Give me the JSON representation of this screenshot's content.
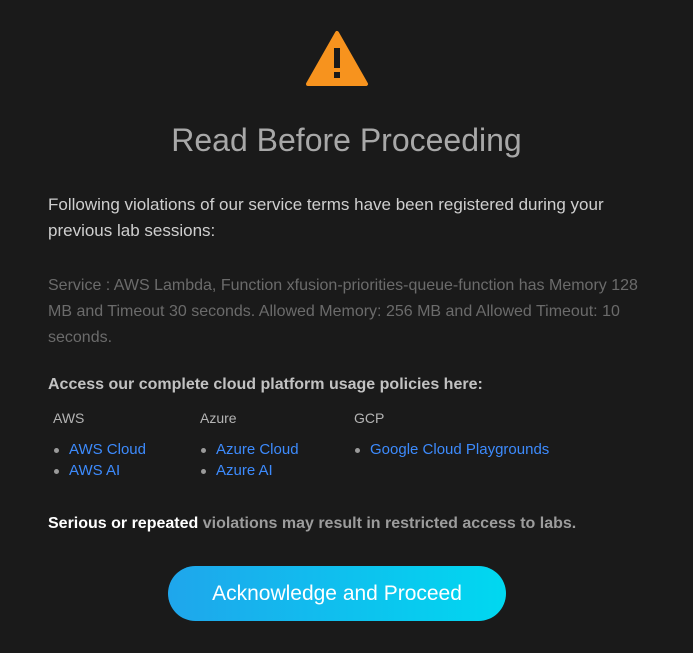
{
  "icons": {
    "warning": "warning-triangle-icon"
  },
  "colors": {
    "background": "#1a1a1a",
    "warning_icon": "#f7931e",
    "link": "#3d8bfd",
    "button_gradient_start": "#1fa6ec",
    "button_gradient_end": "#00d8f0"
  },
  "dialog": {
    "title": "Read Before Proceeding",
    "intro": "Following violations of our service terms have been registered during your previous lab sessions:",
    "violation": "Service : AWS Lambda, Function xfusion-priorities-queue-function has Memory 128 MB and Timeout 30 seconds. Allowed Memory: 256 MB and Allowed Timeout: 10 seconds.",
    "policies_heading": "Access our complete cloud platform usage policies here:",
    "providers": [
      {
        "name": "AWS",
        "links": [
          "AWS Cloud",
          "AWS AI"
        ]
      },
      {
        "name": "Azure",
        "links": [
          "Azure Cloud",
          "Azure AI"
        ]
      },
      {
        "name": "GCP",
        "links": [
          "Google Cloud Playgrounds"
        ]
      }
    ],
    "warning_emphasis": "Serious or repeated",
    "warning_rest": " violations may result in restricted access to labs.",
    "button_label": "Acknowledge and Proceed"
  }
}
